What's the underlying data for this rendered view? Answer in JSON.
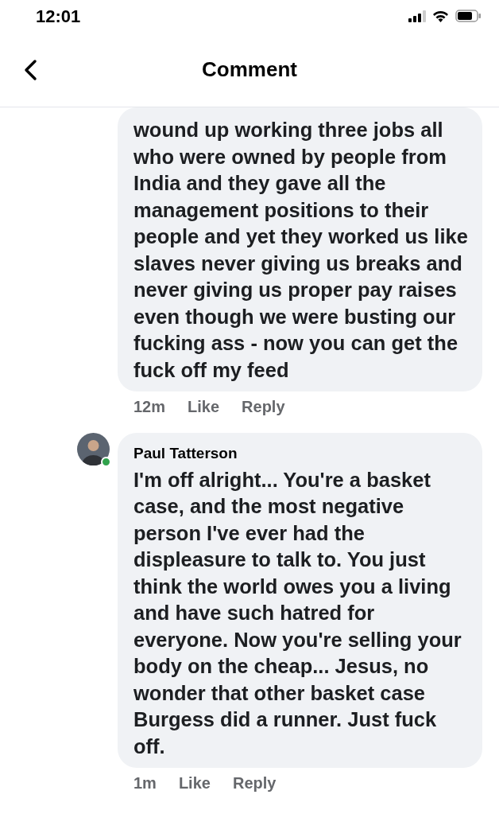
{
  "status_bar": {
    "time": "12:01"
  },
  "header": {
    "title": "Comment"
  },
  "comments": [
    {
      "text": "wound up working three jobs all who were owned by people from India and they gave all the management positions to their people and yet they worked us like slaves never giving us breaks and never giving us proper pay raises even though we were busting our fucking ass - now you can get the fuck off my feed",
      "time": "12m",
      "like": "Like",
      "reply": "Reply"
    },
    {
      "author": "Paul Tatterson",
      "online": true,
      "avatar": true,
      "text": "I'm off alright... You're a basket case, and the most negative person I've ever had the displeasure to talk to. You just think the world owes you a living and have such hatred for everyone. Now you're selling your body on the cheap... Jesus, no wonder that other basket case Burgess did a runner. Just fuck off.",
      "time": "1m",
      "like": "Like",
      "reply": "Reply"
    }
  ]
}
